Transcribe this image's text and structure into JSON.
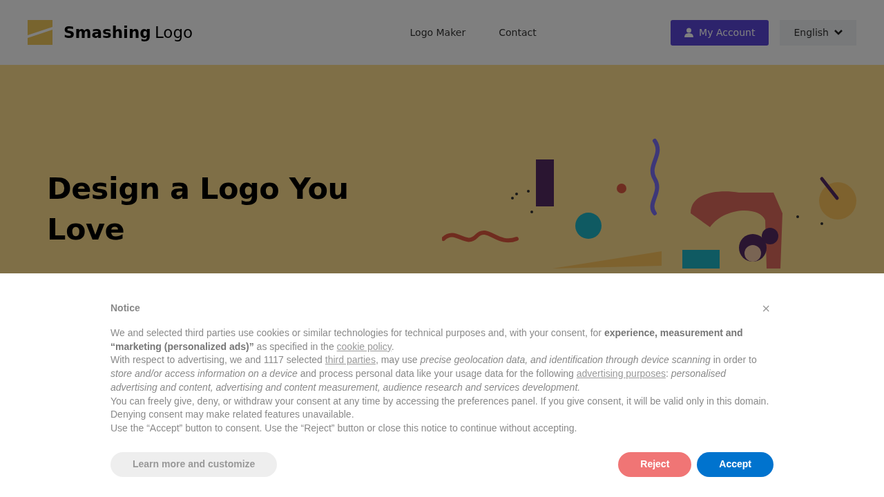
{
  "header": {
    "logo_text_bold": "Smashing",
    "logo_text": "Logo",
    "nav": [
      {
        "label": "Logo Maker"
      },
      {
        "label": "Contact"
      }
    ],
    "account_button": "My Account",
    "language": "English"
  },
  "hero": {
    "title": "Design a Logo You Love"
  },
  "cookie_notice": {
    "title": "Notice",
    "close": "×",
    "paragraphs": [
      [
        {
          "kind": "text",
          "text": "We and selected third parties use cookies or similar technologies for technical purposes and, with your consent, for **experience, measurement and “marketing (personalized ads)”** as specified in the "
        },
        {
          "kind": "link",
          "text": "cookie policy"
        },
        {
          "kind": "text",
          "text": "."
        }
      ],
      [
        {
          "kind": "text",
          "text": "With respect to advertising, we and 1117 selected "
        },
        {
          "kind": "link",
          "text": "third parties"
        },
        {
          "kind": "text",
          "text": ", may use *precise geolocation data, and identification through device scanning* in order to *store and/or access information on a device* and process personal data like your usage data for the following "
        },
        {
          "kind": "link",
          "text": "advertising purposes"
        },
        {
          "kind": "text",
          "text": ": *personalised advertising and content, advertising and content measurement, audience research and services development.*"
        }
      ],
      [
        {
          "kind": "text",
          "text": "You can freely give, deny, or withdraw your consent at any time by accessing the preferences panel. If you give consent, it will be valid only in this domain. Denying consent may make related features unavailable."
        }
      ],
      [
        {
          "kind": "text",
          "text": "Use the “Accept” button to consent. Use the “Reject” button or close this notice to continue without accepting."
        }
      ]
    ],
    "buttons": [
      {
        "kind": "secondary",
        "label": "Learn more and customize"
      },
      {
        "kind": "reject",
        "label": "Reject"
      },
      {
        "kind": "accept",
        "label": "Accept"
      }
    ]
  }
}
